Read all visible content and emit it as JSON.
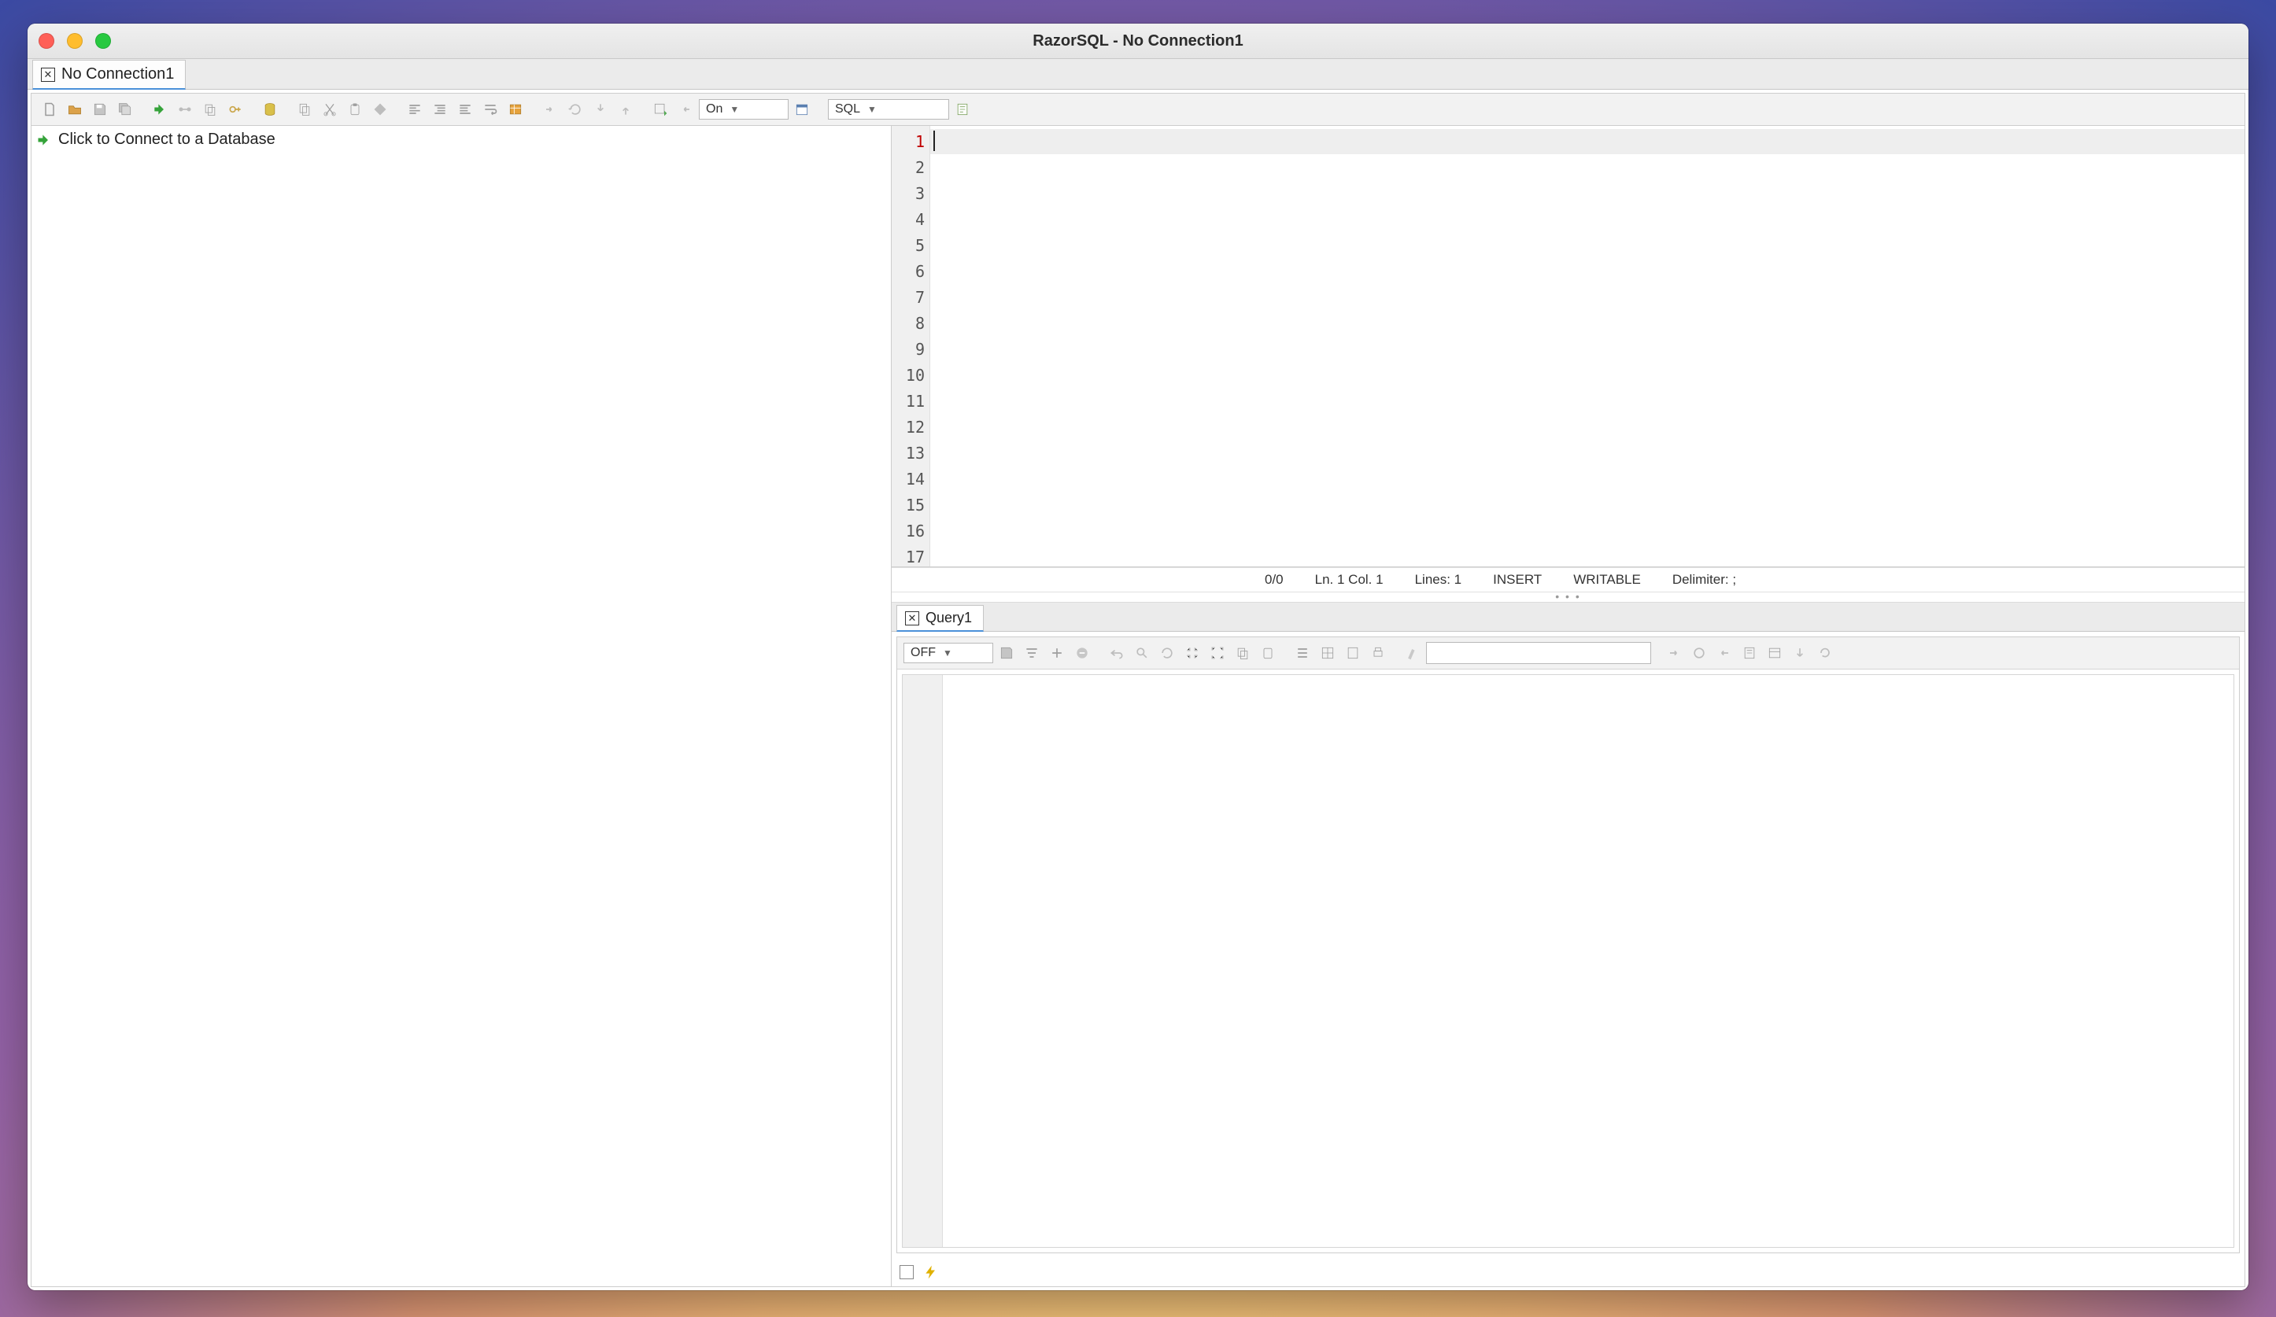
{
  "window": {
    "title": "RazorSQL - No Connection1"
  },
  "tabs": {
    "main_tab_label": "No Connection1"
  },
  "toolbar": {
    "autocomplete_combo": "On",
    "language_combo": "SQL"
  },
  "sidebar": {
    "connect_prompt": "Click to Connect to a Database"
  },
  "editor": {
    "line_numbers": [
      "1",
      "2",
      "3",
      "4",
      "5",
      "6",
      "7",
      "8",
      "9",
      "10",
      "11",
      "12",
      "13",
      "14",
      "15",
      "16",
      "17"
    ]
  },
  "status": {
    "position": "0/0",
    "cursor": "Ln. 1 Col. 1",
    "lines": "Lines: 1",
    "mode": "INSERT",
    "writable": "WRITABLE",
    "delimiter": "Delimiter: ;"
  },
  "query_tab": {
    "label": "Query1"
  },
  "results_toolbar": {
    "filter_combo": "OFF"
  }
}
